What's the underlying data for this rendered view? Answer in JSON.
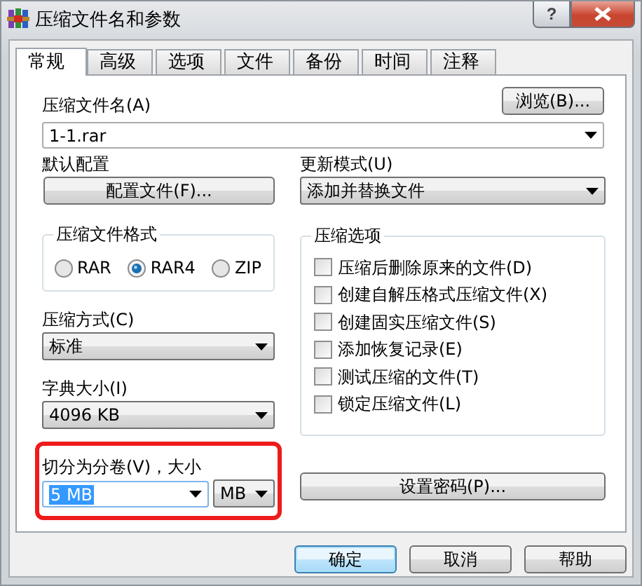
{
  "window": {
    "title": "压缩文件名和参数",
    "help_button": "?"
  },
  "tabs": [
    {
      "label": "常规",
      "selected": true
    },
    {
      "label": "高级",
      "selected": false
    },
    {
      "label": "选项",
      "selected": false
    },
    {
      "label": "文件",
      "selected": false
    },
    {
      "label": "备份",
      "selected": false
    },
    {
      "label": "时间",
      "selected": false
    },
    {
      "label": "注释",
      "selected": false
    }
  ],
  "archive_name": {
    "label": "压缩文件名(A)",
    "value": "1-1.rar",
    "browse_button": "浏览(B)..."
  },
  "profile": {
    "label": "默认配置",
    "button": "配置文件(F)..."
  },
  "update_mode": {
    "label": "更新模式(U)",
    "value": "添加并替换文件"
  },
  "archive_format": {
    "title": "压缩文件格式",
    "options": [
      {
        "label": "RAR",
        "selected": false
      },
      {
        "label": "RAR4",
        "selected": true
      },
      {
        "label": "ZIP",
        "selected": false
      }
    ]
  },
  "compression_method": {
    "label": "压缩方式(C)",
    "value": "标准"
  },
  "dictionary_size": {
    "label": "字典大小(I)",
    "value": "4096 KB"
  },
  "split_volumes": {
    "label": "切分为分卷(V)，大小",
    "value": "5 MB",
    "unit": "MB",
    "highlighted": true
  },
  "archive_options": {
    "title": "压缩选项",
    "options": [
      {
        "label": "压缩后删除原来的文件(D)",
        "checked": false
      },
      {
        "label": "创建自解压格式压缩文件(X)",
        "checked": false
      },
      {
        "label": "创建固实压缩文件(S)",
        "checked": false
      },
      {
        "label": "添加恢复记录(E)",
        "checked": false
      },
      {
        "label": "测试压缩的文件(T)",
        "checked": false
      },
      {
        "label": "锁定压缩文件(L)",
        "checked": false
      }
    ]
  },
  "password_button": "设置密码(P)...",
  "buttons": [
    {
      "label": "确定",
      "default": true
    },
    {
      "label": "取消",
      "default": false
    },
    {
      "label": "帮助",
      "default": false
    }
  ]
}
